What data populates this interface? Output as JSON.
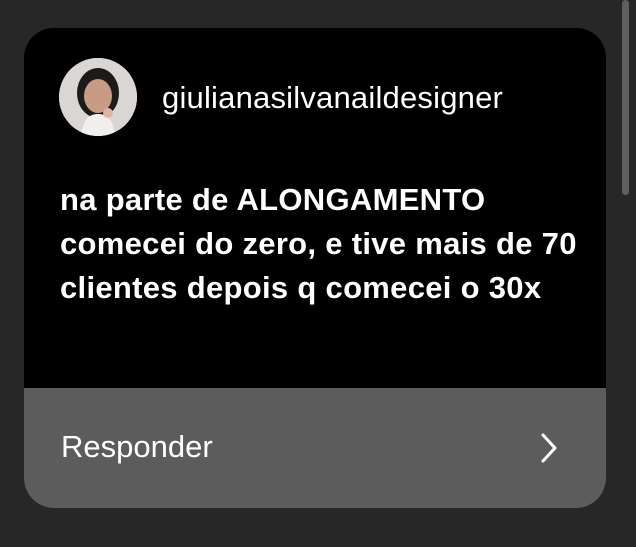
{
  "comment": {
    "username": "giulianasilvanaildesigner",
    "message": "na parte de ALONGAMENTO comecei do zero, e tive mais de 70 clientes depois q comecei o 30x",
    "avatar_icon": "profile-photo"
  },
  "reply": {
    "label": "Responder",
    "icon": "chevron-right-icon"
  },
  "colors": {
    "background": "#272727",
    "card": "#000000",
    "reply_bar": "#5c5c5c",
    "text": "#ffffff"
  }
}
